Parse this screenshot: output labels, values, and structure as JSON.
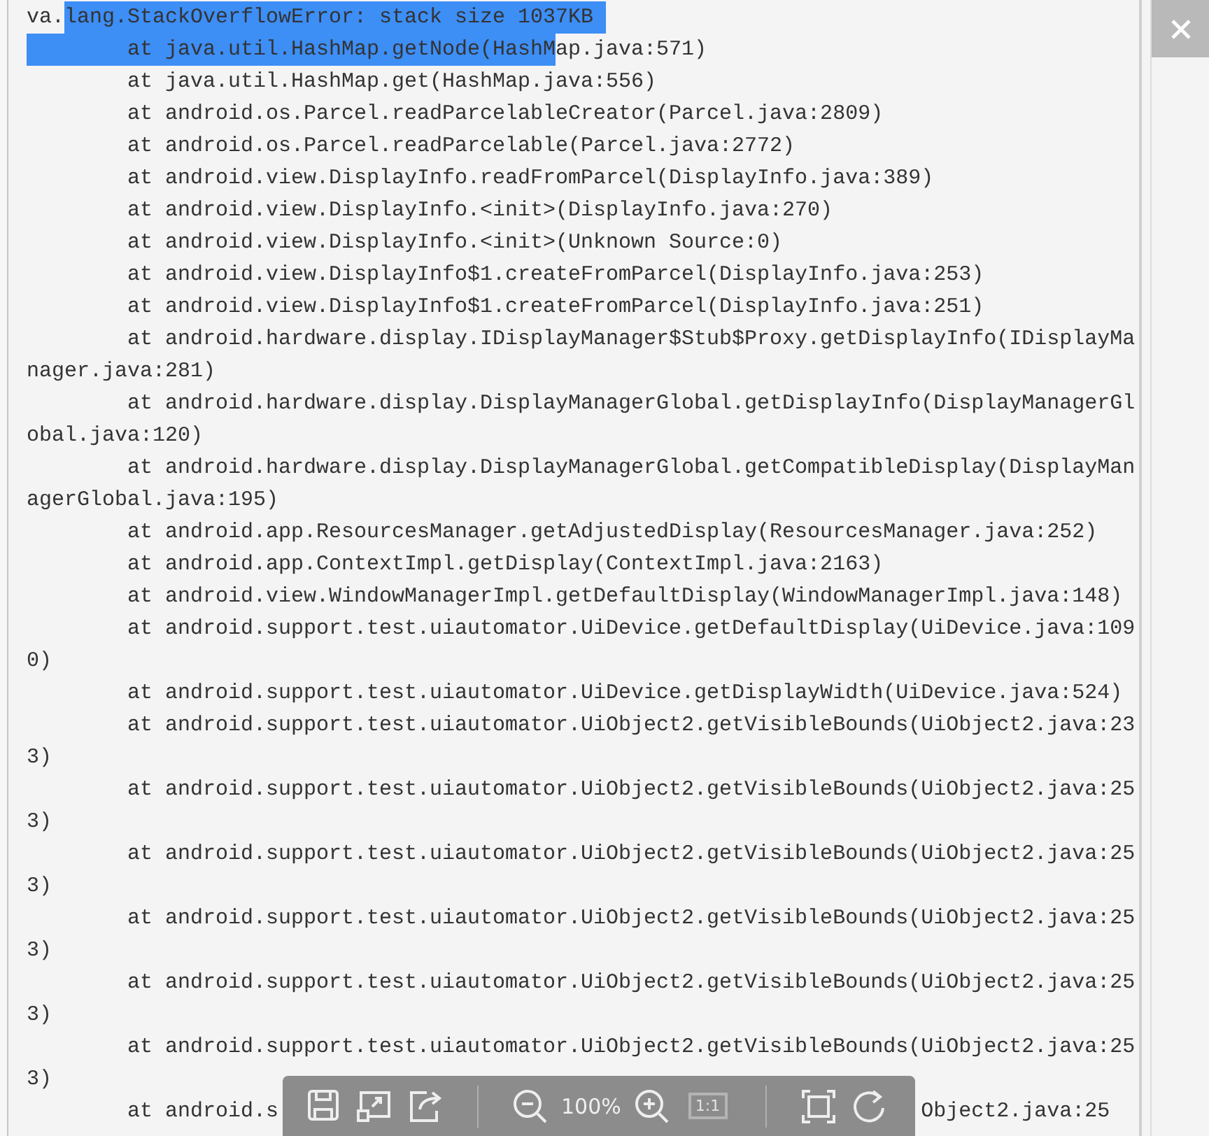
{
  "document": {
    "lines": [
      [
        {
          "text": "va.",
          "selected": false
        },
        {
          "text": "lang.StackOverflowError: stack size 1037KB ",
          "selected": true
        }
      ],
      [
        {
          "text": "        at java.util.HashMap.getNode(HashM",
          "selected": true
        },
        {
          "text": "ap.java:571)",
          "selected": false
        }
      ],
      [
        {
          "text": "        at java.util.HashMap.get(HashMap.java:556)",
          "selected": false
        }
      ],
      [
        {
          "text": "        at android.os.Parcel.readParcelableCreator(Parcel.java:2809)",
          "selected": false
        }
      ],
      [
        {
          "text": "        at android.os.Parcel.readParcelable(Parcel.java:2772)",
          "selected": false
        }
      ],
      [
        {
          "text": "        at android.view.DisplayInfo.readFromParcel(DisplayInfo.java:389)",
          "selected": false
        }
      ],
      [
        {
          "text": "        at android.view.DisplayInfo.<init>(DisplayInfo.java:270)",
          "selected": false
        }
      ],
      [
        {
          "text": "        at android.view.DisplayInfo.<init>(Unknown Source:0)",
          "selected": false
        }
      ],
      [
        {
          "text": "        at android.view.DisplayInfo$1.createFromParcel(DisplayInfo.java:253)",
          "selected": false
        }
      ],
      [
        {
          "text": "        at android.view.DisplayInfo$1.createFromParcel(DisplayInfo.java:251)",
          "selected": false
        }
      ],
      [
        {
          "text": "        at android.hardware.display.IDisplayManager$Stub$Proxy.getDisplayInfo(IDisplayMa",
          "selected": false
        }
      ],
      [
        {
          "text": "nager.java:281)",
          "selected": false
        }
      ],
      [
        {
          "text": "        at android.hardware.display.DisplayManagerGlobal.getDisplayInfo(DisplayManagerGl",
          "selected": false
        }
      ],
      [
        {
          "text": "obal.java:120)",
          "selected": false
        }
      ],
      [
        {
          "text": "        at android.hardware.display.DisplayManagerGlobal.getCompatibleDisplay(DisplayMan",
          "selected": false
        }
      ],
      [
        {
          "text": "agerGlobal.java:195)",
          "selected": false
        }
      ],
      [
        {
          "text": "        at android.app.ResourcesManager.getAdjustedDisplay(ResourcesManager.java:252)",
          "selected": false
        }
      ],
      [
        {
          "text": "        at android.app.ContextImpl.getDisplay(ContextImpl.java:2163)",
          "selected": false
        }
      ],
      [
        {
          "text": "        at android.view.WindowManagerImpl.getDefaultDisplay(WindowManagerImpl.java:148)",
          "selected": false
        }
      ],
      [
        {
          "text": "        at android.support.test.uiautomator.UiDevice.getDefaultDisplay(UiDevice.java:109",
          "selected": false
        }
      ],
      [
        {
          "text": "0)",
          "selected": false
        }
      ],
      [
        {
          "text": "        at android.support.test.uiautomator.UiDevice.getDisplayWidth(UiDevice.java:524)",
          "selected": false
        }
      ],
      [
        {
          "text": "        at android.support.test.uiautomator.UiObject2.getVisibleBounds(UiObject2.java:23",
          "selected": false
        }
      ],
      [
        {
          "text": "3)",
          "selected": false
        }
      ],
      [
        {
          "text": "        at android.support.test.uiautomator.UiObject2.getVisibleBounds(UiObject2.java:25",
          "selected": false
        }
      ],
      [
        {
          "text": "3)",
          "selected": false
        }
      ],
      [
        {
          "text": "        at android.support.test.uiautomator.UiObject2.getVisibleBounds(UiObject2.java:25",
          "selected": false
        }
      ],
      [
        {
          "text": "3)",
          "selected": false
        }
      ],
      [
        {
          "text": "        at android.support.test.uiautomator.UiObject2.getVisibleBounds(UiObject2.java:25",
          "selected": false
        }
      ],
      [
        {
          "text": "3)",
          "selected": false
        }
      ],
      [
        {
          "text": "        at android.support.test.uiautomator.UiObject2.getVisibleBounds(UiObject2.java:25",
          "selected": false
        }
      ],
      [
        {
          "text": "3)",
          "selected": false
        }
      ],
      [
        {
          "text": "        at android.support.test.uiautomator.UiObject2.getVisibleBounds(UiObject2.java:25",
          "selected": false
        }
      ],
      [
        {
          "text": "3)",
          "selected": false
        }
      ],
      [
        {
          "text": "        at android.s",
          "selected": false
        },
        {
          "text": "Object2.java:25",
          "selected": false
        }
      ]
    ]
  },
  "toolbar": {
    "items": [
      {
        "kind": "save",
        "disabled": false
      },
      {
        "kind": "fit",
        "disabled": false
      },
      {
        "kind": "share",
        "disabled": false
      },
      {
        "kind": "divider",
        "disabled": false
      },
      {
        "kind": "zoom-out",
        "disabled": false
      },
      {
        "kind": "zoom-level",
        "text": "100%",
        "disabled": false
      },
      {
        "kind": "zoom-in",
        "disabled": false
      },
      {
        "kind": "actual-size",
        "text": "1:1",
        "disabled": true
      },
      {
        "kind": "divider",
        "disabled": false
      },
      {
        "kind": "fullscreen",
        "disabled": false
      },
      {
        "kind": "rotate",
        "disabled": false
      }
    ]
  }
}
